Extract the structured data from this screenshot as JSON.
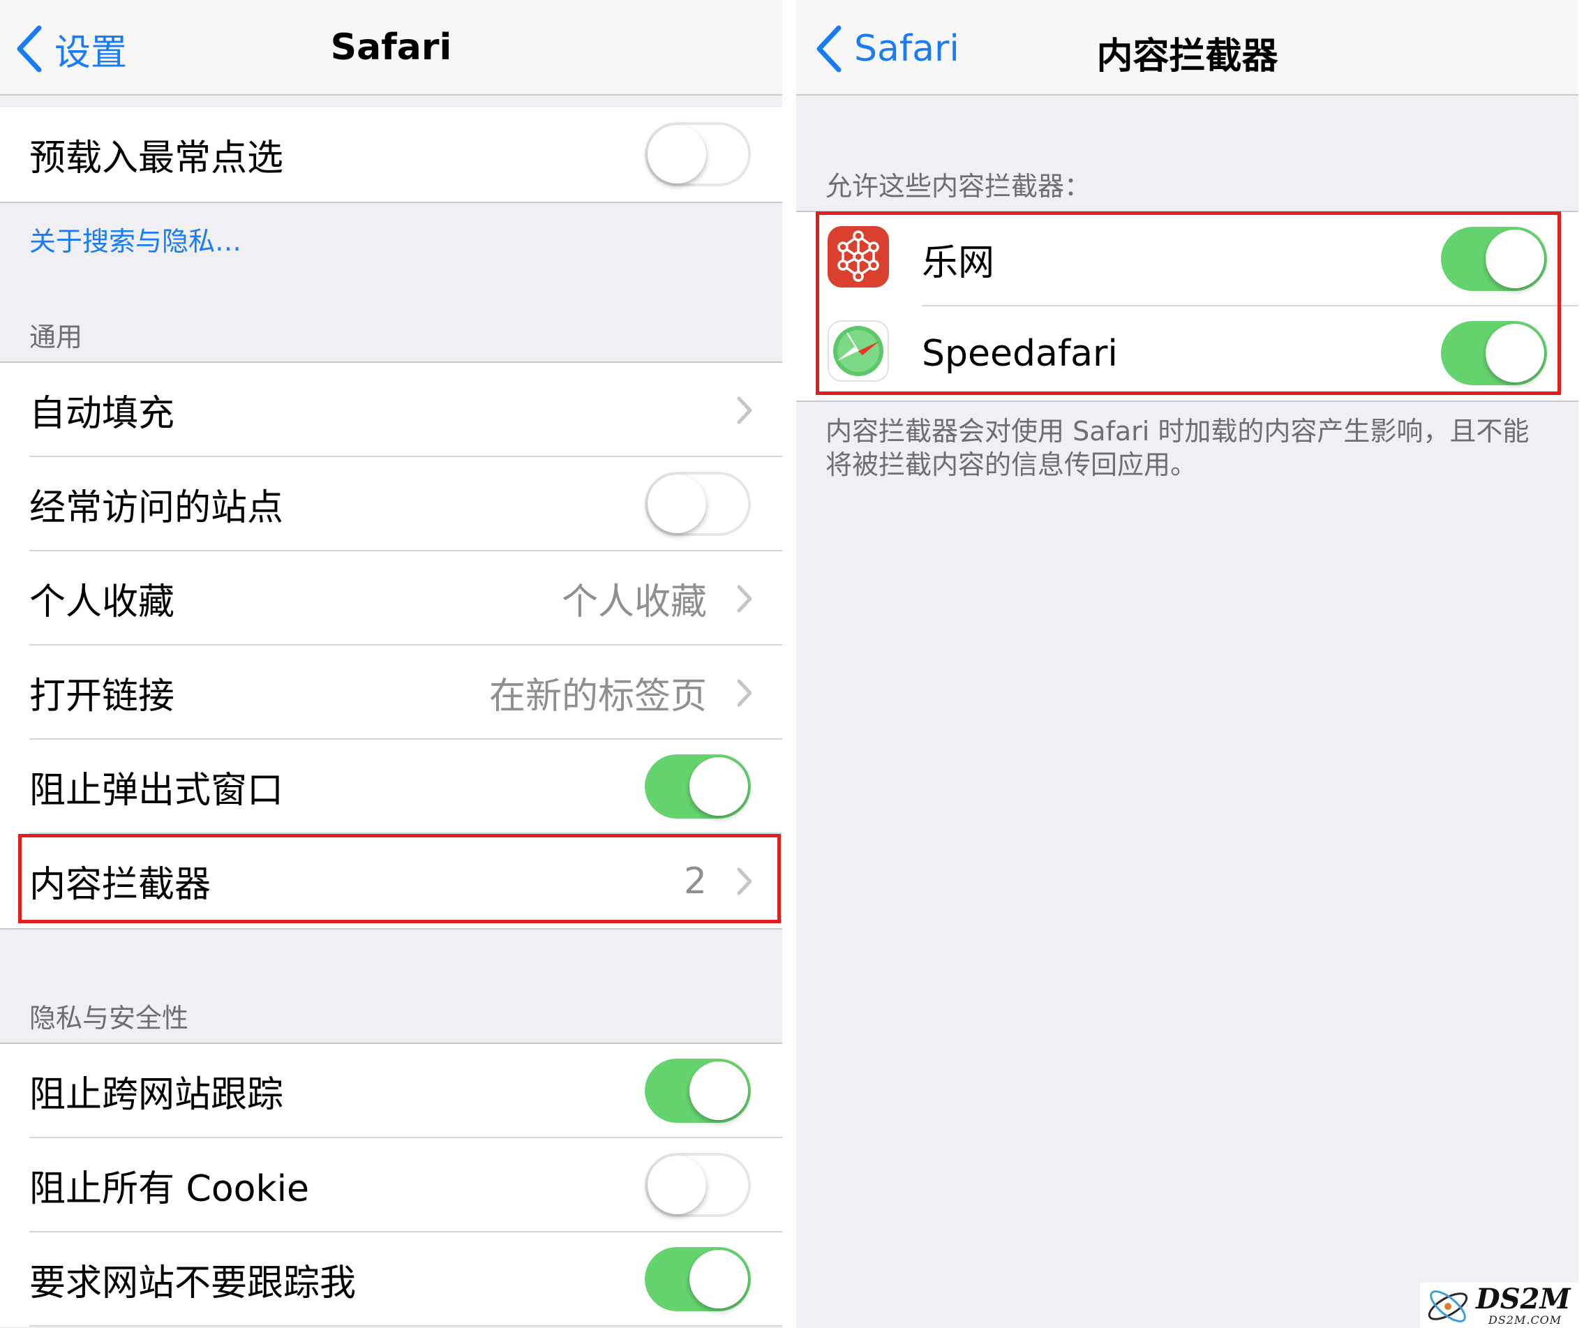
{
  "left": {
    "nav": {
      "back_label": "设置",
      "title": "Safari"
    },
    "preload_row": {
      "label": "预载入最常点选",
      "toggle": "off"
    },
    "privacy_link": "关于搜索与隐私…",
    "general_header": "通用",
    "general_rows": [
      {
        "label": "自动填充",
        "value": "",
        "control": "chevron"
      },
      {
        "label": "经常访问的站点",
        "value": "",
        "control": "toggle-off"
      },
      {
        "label": "个人收藏",
        "value": "个人收藏",
        "control": "chevron"
      },
      {
        "label": "打开链接",
        "value": "在新的标签页",
        "control": "chevron"
      },
      {
        "label": "阻止弹出式窗口",
        "value": "",
        "control": "toggle-on"
      },
      {
        "label": "内容拦截器",
        "value": "2",
        "control": "chevron"
      }
    ],
    "privacy_header": "隐私与安全性",
    "privacy_rows": [
      {
        "label": "阻止跨网站跟踪",
        "control": "toggle-on"
      },
      {
        "label": "阻止所有 Cookie",
        "control": "toggle-off"
      },
      {
        "label": "要求网站不要跟踪我",
        "control": "toggle-on"
      }
    ]
  },
  "right": {
    "nav": {
      "back_label": "Safari",
      "title": "内容拦截器"
    },
    "section_header": "允许这些内容拦截器：",
    "blockers": [
      {
        "name": "乐网",
        "icon": "lewang-network-icon",
        "enabled": true
      },
      {
        "name": "Speedafari",
        "icon": "speedafari-compass-icon",
        "enabled": true
      }
    ],
    "footer": "内容拦截器会对使用 Safari 时加载的内容产生影响，且不能将被拦截内容的信息传回应用。"
  },
  "watermark": {
    "big": "DS2M",
    "small": "DS2M.COM"
  },
  "colors": {
    "ios_blue": "#1a7cf5",
    "toggle_on": "#65d46e",
    "highlight_red": "#e11f1f",
    "grouped_bg": "#efeff4",
    "secondary_text": "#8e8e93",
    "app_red": "#d9412e"
  }
}
